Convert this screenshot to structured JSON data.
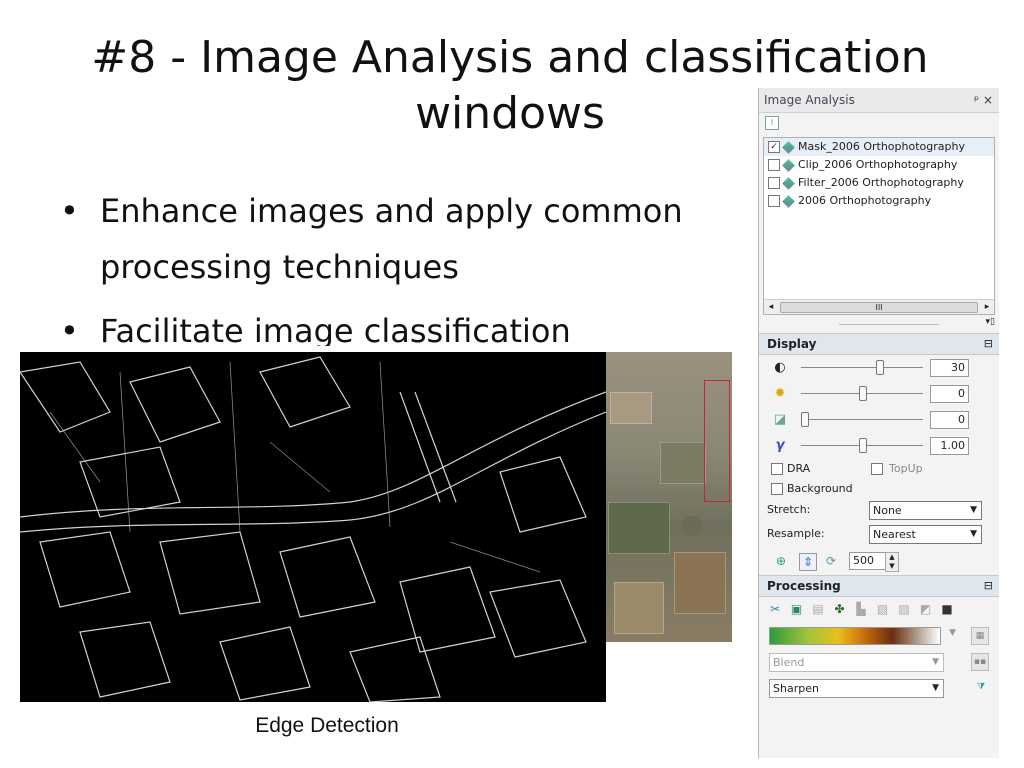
{
  "slide": {
    "title_line1": "#8 - Image Analysis and classification",
    "title_line2": "windows",
    "bullets": [
      "Enhance images and apply common",
      "processing techniques",
      "Facilitate image classification"
    ],
    "bullet_glyph": "•",
    "caption": "Edge Detection"
  },
  "panel": {
    "title": "Image Analysis",
    "controls": "ᵖ ×",
    "layers": [
      {
        "label": "Mask_2006 Orthophotography",
        "checked": true
      },
      {
        "label": "Clip_2006 Orthophotography",
        "checked": false
      },
      {
        "label": "Filter_2006 Orthophotography",
        "checked": false
      },
      {
        "label": "2006 Orthophotography",
        "checked": false
      }
    ],
    "scroll_thumb": "III",
    "display": {
      "header": "Display",
      "collapse": "⊟",
      "contrast": {
        "value": "30",
        "level": 0.65,
        "icon": "contrast-icon"
      },
      "brightness": {
        "value": "0",
        "level": 0.5,
        "icon": "brightness-icon"
      },
      "transparency": {
        "value": "0",
        "level": 0.0,
        "icon": "transparency-icon"
      },
      "gamma": {
        "value": "1.00",
        "level": 0.5,
        "icon": "gamma-icon",
        "glyph": "γ"
      },
      "dra_label": "DRA",
      "topup_label": "TopUp",
      "background_label": "Background",
      "stretch_label": "Stretch:",
      "stretch_value": "None",
      "resample_label": "Resample:",
      "resample_value": "Nearest",
      "spin_value": "500"
    },
    "processing": {
      "header": "Processing",
      "collapse": "⊟",
      "blend_label": "Blend",
      "sharpen_label": "Sharpen"
    }
  },
  "colors": {
    "accent": "#2f6fbf",
    "section_bg": "#dfe6ee",
    "roi_outline": "#cc2233"
  }
}
